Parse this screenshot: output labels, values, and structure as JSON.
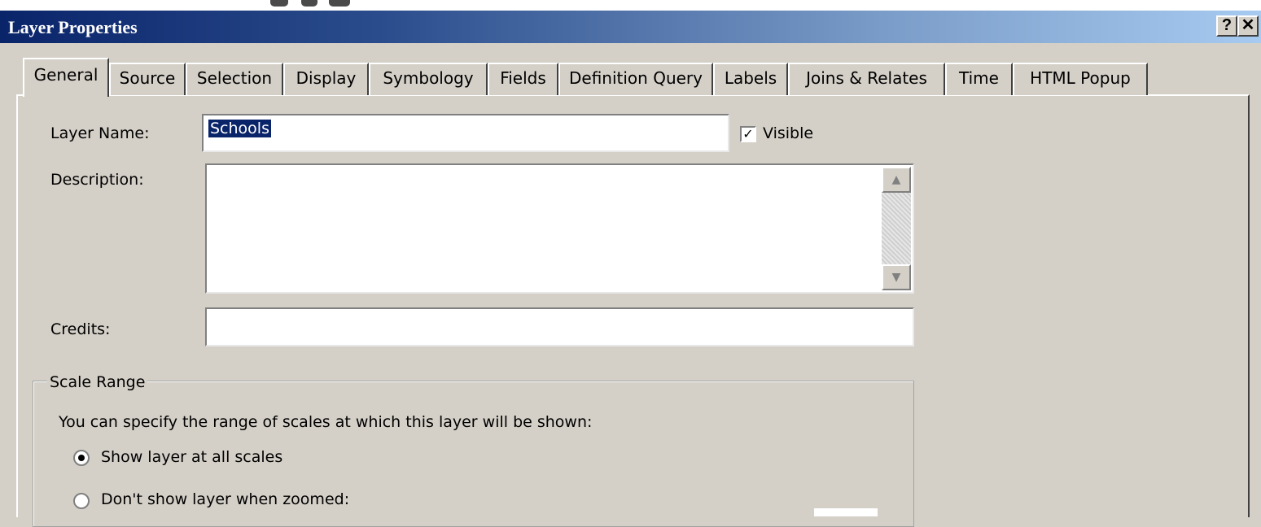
{
  "window": {
    "title": "Layer Properties",
    "help_label": "?",
    "close_label": "✕"
  },
  "tabs": [
    {
      "label": "General",
      "active": true
    },
    {
      "label": "Source"
    },
    {
      "label": "Selection"
    },
    {
      "label": "Display"
    },
    {
      "label": "Symbology"
    },
    {
      "label": "Fields"
    },
    {
      "label": "Definition Query"
    },
    {
      "label": "Labels"
    },
    {
      "label": "Joins & Relates"
    },
    {
      "label": "Time"
    },
    {
      "label": "HTML Popup"
    }
  ],
  "general": {
    "layer_name_label": "Layer Name:",
    "layer_name_value": "Schools",
    "visible_label": "Visible",
    "visible_checked": true,
    "description_label": "Description:",
    "description_value": "",
    "credits_label": "Credits:",
    "credits_value": "",
    "scale_range": {
      "legend": "Scale Range",
      "intro": "You can specify the range of scales at which this layer will be shown:",
      "options": [
        {
          "label": "Show layer at all scales",
          "selected": true
        },
        {
          "label": "Don't show layer when zoomed:",
          "selected": false
        }
      ]
    }
  },
  "colors": {
    "titlebar_start": "#0a246a",
    "titlebar_end": "#a6caf0",
    "dialog_bg": "#d4d0c8",
    "selection": "#0a246a"
  },
  "icons": {
    "help": "question-icon",
    "close": "close-icon",
    "scroll_up": "triangle-up-icon",
    "scroll_down": "triangle-down-icon"
  }
}
